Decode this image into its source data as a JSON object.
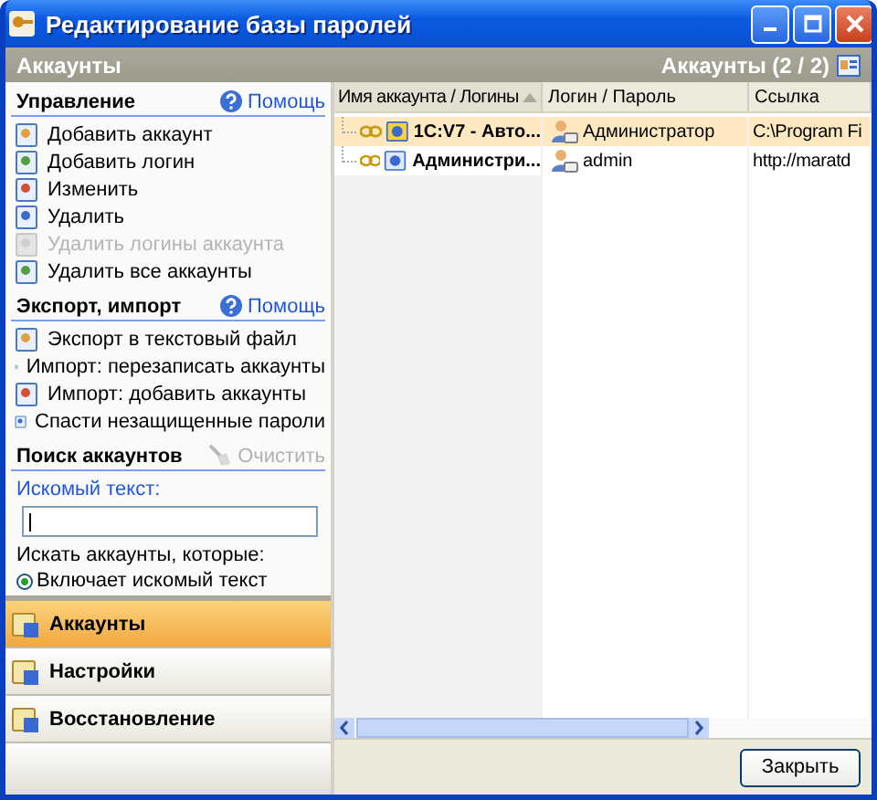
{
  "window": {
    "title": "Редактирование базы паролей"
  },
  "header": {
    "title": "Аккаунты",
    "count": "Аккаунты (2 / 2)"
  },
  "sections": [
    {
      "title": "Управление",
      "help": "Помощь",
      "items": [
        {
          "label": "Добавить аккаунт",
          "disabled": false
        },
        {
          "label": "Добавить логин",
          "disabled": false
        },
        {
          "label": "Изменить",
          "disabled": false
        },
        {
          "label": "Удалить",
          "disabled": false
        },
        {
          "label": "Удалить логины аккаунта",
          "disabled": true
        },
        {
          "label": "Удалить все аккаунты",
          "disabled": false
        }
      ]
    },
    {
      "title": "Экспорт, импорт",
      "help": "Помощь",
      "items": [
        {
          "label": "Экспорт в текстовый файл",
          "disabled": false
        },
        {
          "label": "Импорт: перезаписать аккаунты",
          "disabled": false
        },
        {
          "label": "Импорт: добавить аккаунты",
          "disabled": false
        },
        {
          "label": "Спасти незащищенные пароли",
          "disabled": false
        }
      ]
    }
  ],
  "search": {
    "title": "Поиск аккаунтов",
    "clear": "Очистить",
    "clear_disabled": true,
    "field_label": "Искомый текст:",
    "filter_label": "Искать аккаунты, которые:",
    "option": {
      "label": "Включает искомый текст",
      "selected": true
    }
  },
  "nav": [
    {
      "label": "Аккаунты",
      "selected": true
    },
    {
      "label": "Настройки",
      "selected": false
    },
    {
      "label": "Восстановление",
      "selected": false
    }
  ],
  "table": {
    "columns": [
      {
        "label": "Имя аккаунта / Логины",
        "sorted": true
      },
      {
        "label": "Логин / Пароль",
        "sorted": false
      },
      {
        "label": "Ссылка",
        "sorted": false
      }
    ],
    "rows": [
      {
        "name": "1C:V7 - Авто...",
        "login": "Администратор",
        "link": "C:\\Program Fi",
        "selected": true
      },
      {
        "name": "Администри...",
        "login": "admin",
        "link": "http://maratd",
        "selected": false
      }
    ]
  },
  "buttons": {
    "close": "Закрыть"
  }
}
